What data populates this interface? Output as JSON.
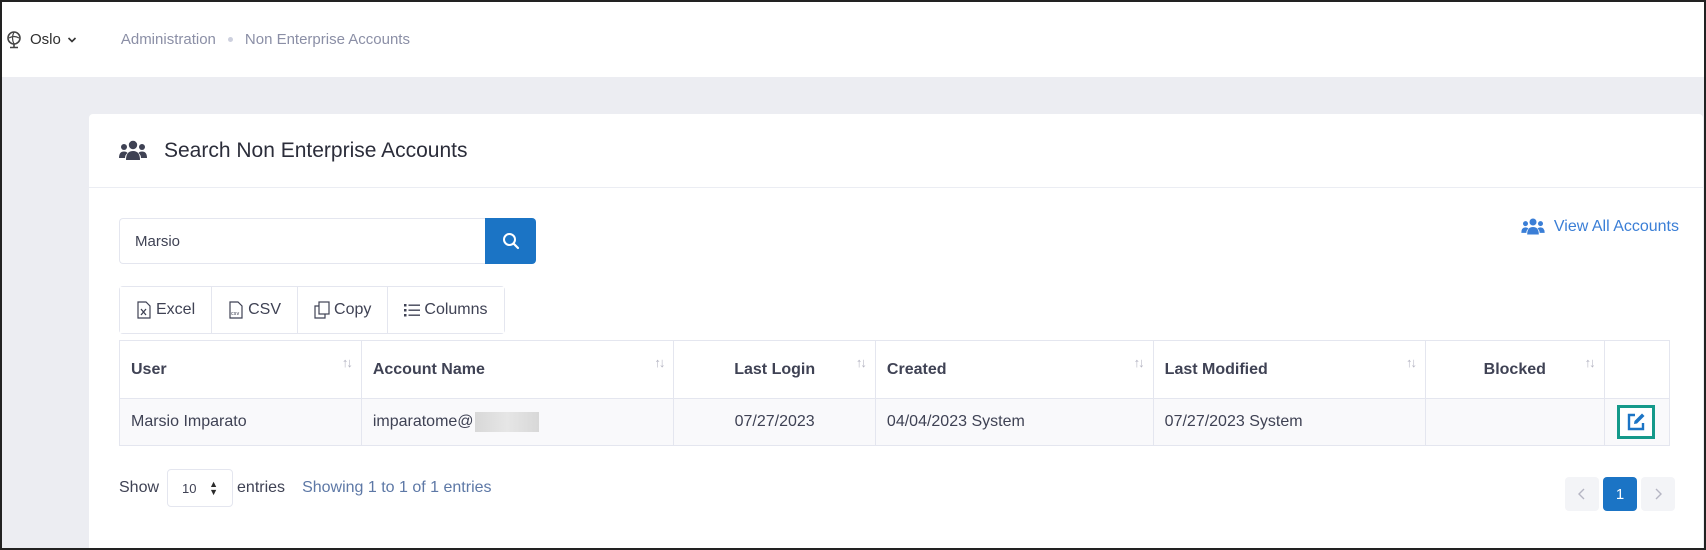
{
  "header": {
    "location": "Oslo",
    "breadcrumbs": [
      "Administration",
      "Non Enterprise Accounts"
    ]
  },
  "card": {
    "title": "Search Non Enterprise Accounts"
  },
  "search": {
    "value": "Marsio"
  },
  "view_all_label": "View All Accounts",
  "toolbar": {
    "excel": "Excel",
    "csv": "CSV",
    "copy": "Copy",
    "columns": "Columns"
  },
  "table": {
    "columns": [
      "User",
      "Account Name",
      "Last Login",
      "Created",
      "Last Modified",
      "Blocked"
    ],
    "rows": [
      {
        "user": "Marsio Imparato",
        "account_name": "imparatome@",
        "last_login": "07/27/2023",
        "created": "04/04/2023 System",
        "last_modified": "07/27/2023 System",
        "blocked": ""
      }
    ]
  },
  "footer": {
    "show_label": "Show",
    "page_length": "10",
    "entries_label": "entries",
    "info": "Showing 1 to 1 of 1 entries",
    "current_page": "1"
  },
  "colors": {
    "primary": "#1b74c5",
    "link": "#3a7ed6",
    "highlight": "#14998a"
  }
}
